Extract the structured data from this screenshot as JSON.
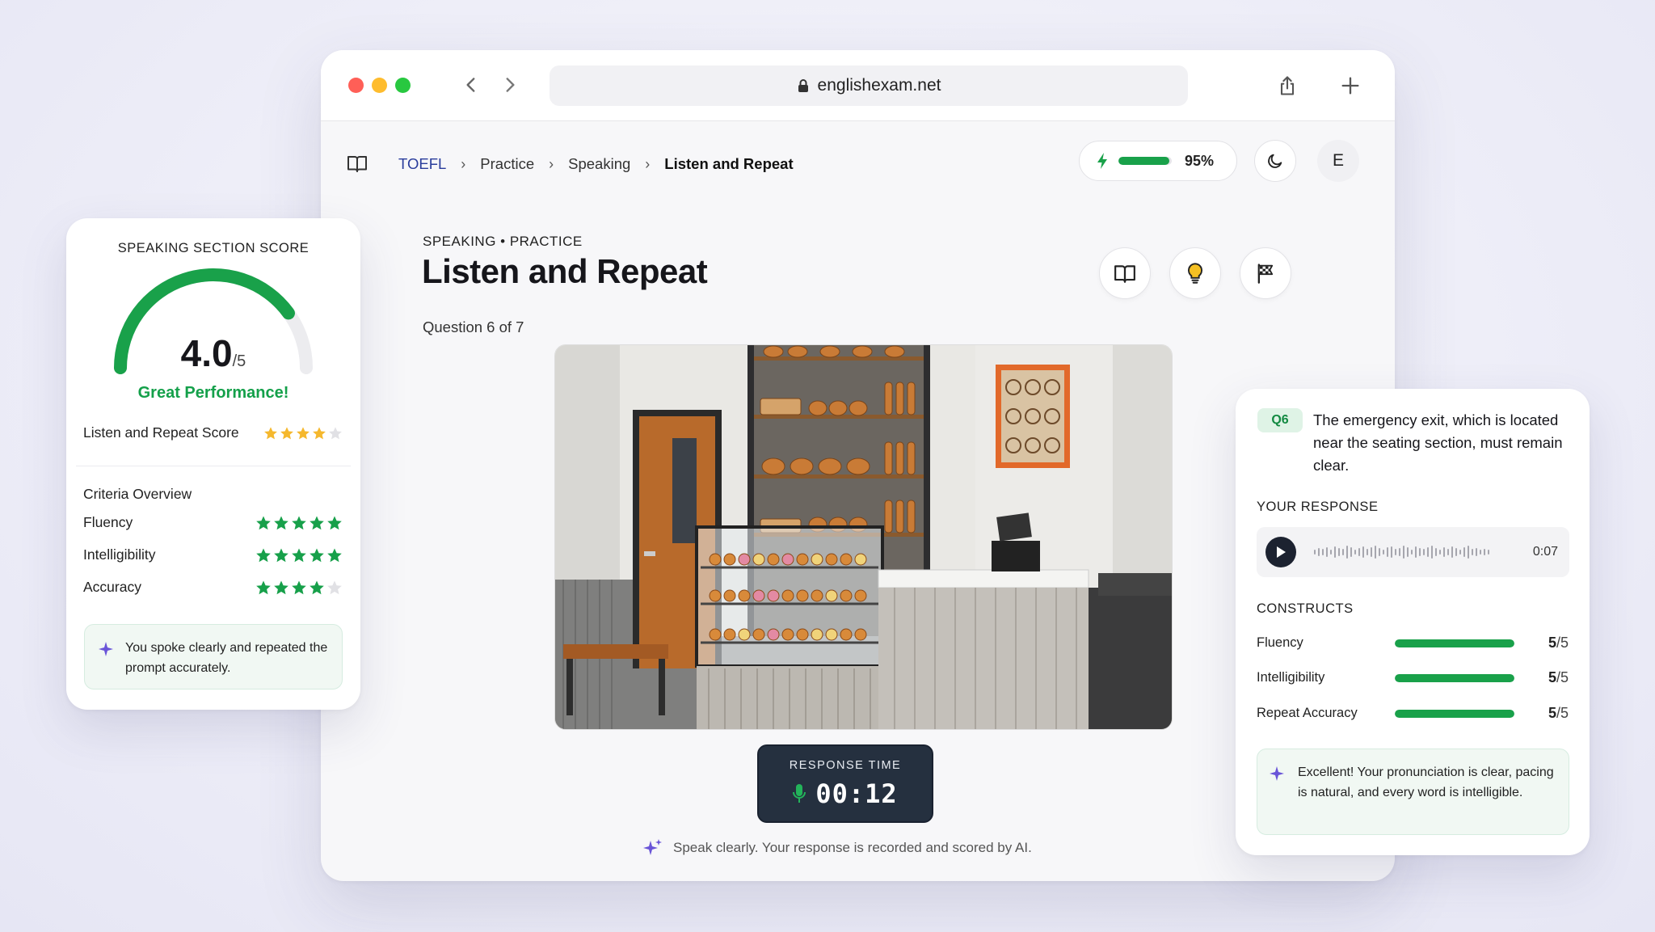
{
  "browser": {
    "url": "englishexam.net"
  },
  "nav": {
    "breadcrumb": [
      "TOEFL",
      "Practice",
      "Speaking",
      "Listen and Repeat"
    ],
    "progress_percent": 95,
    "progress_label": "95%",
    "avatar_initial": "E"
  },
  "main": {
    "eyebrow": "SPEAKING • PRACTICE",
    "title": "Listen and Repeat",
    "question_count": "Question 6 of 7",
    "timer_label": "RESPONSE TIME",
    "timer_value": "00:12",
    "hint": "Speak clearly. Your response is recorded and scored by AI."
  },
  "score_card": {
    "heading": "SPEAKING SECTION SCORE",
    "score": "4.0",
    "score_max": "/5",
    "score_value": 4.0,
    "score_out_of": 5,
    "verdict": "Great Performance!",
    "listen_repeat_label": "Listen and Repeat Score",
    "listen_repeat_stars": 4,
    "criteria_title": "Criteria Overview",
    "criteria": [
      {
        "label": "Fluency",
        "stars": 5
      },
      {
        "label": "Intelligibility",
        "stars": 5
      },
      {
        "label": "Accuracy",
        "stars": 4
      }
    ],
    "note": "You spoke clearly and repeated the prompt accurately."
  },
  "response_card": {
    "tag": "Q6",
    "prompt": "The emergency exit, which is located near the seating section, must remain clear.",
    "your_response_label": "YOUR RESPONSE",
    "audio_time": "0:07",
    "constructs_label": "CONSTRUCTS",
    "constructs": [
      {
        "label": "Fluency",
        "score": "5",
        "max": "/5",
        "fraction": 1.0
      },
      {
        "label": "Intelligibility",
        "score": "5",
        "max": "/5",
        "fraction": 1.0
      },
      {
        "label": "Repeat Accuracy",
        "score": "5",
        "max": "/5",
        "fraction": 1.0
      }
    ],
    "note": "Excellent! Your pronunciation is clear, pacing is natural, and every word is intelligible."
  },
  "colors": {
    "accent_green": "#19a14a",
    "star_gold": "#f5b82e",
    "star_green": "#17a04a",
    "link_blue": "#2a3d9c",
    "sparkle_purple": "#6a55d8"
  }
}
